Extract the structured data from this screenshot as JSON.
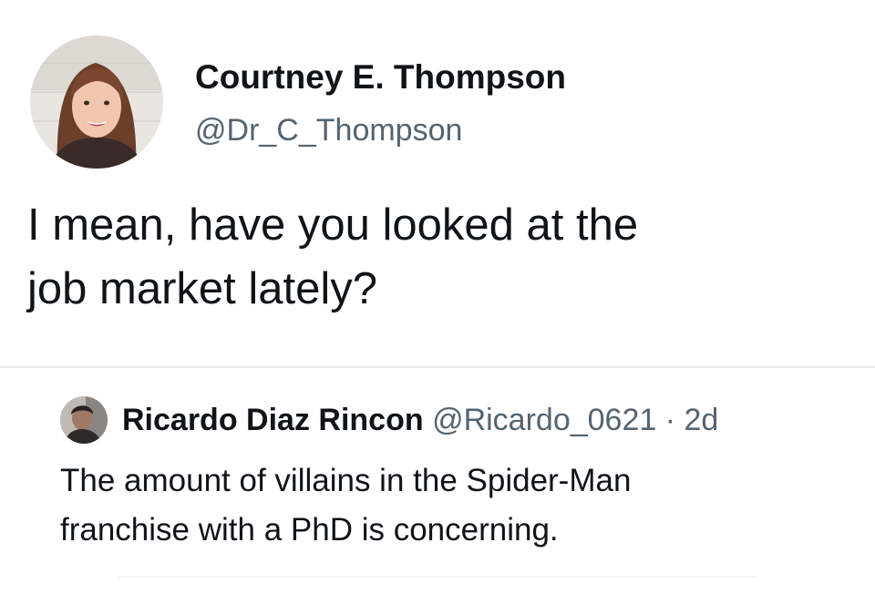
{
  "tweet": {
    "author": {
      "display_name": "Courtney E. Thompson",
      "handle": "@Dr_C_Thompson",
      "avatar_icon": "woman-portrait-avatar"
    },
    "text_lines": [
      "I mean, have you looked at the",
      "job market lately?"
    ]
  },
  "quoted_tweet": {
    "author": {
      "display_name": "Ricardo Diaz Rincon",
      "handle": "@Ricardo_0621",
      "separator": "·",
      "timestamp": "2d",
      "avatar_icon": "man-portrait-avatar"
    },
    "text_lines": [
      "The amount of villains in the Spider-Man",
      "franchise with a PhD is concerning."
    ]
  },
  "colors": {
    "text_primary": "#0f1419",
    "text_secondary": "#536471",
    "divider": "#e4e8eb"
  }
}
